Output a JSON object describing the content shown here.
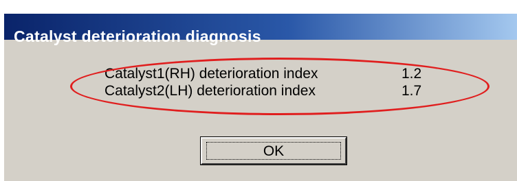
{
  "window": {
    "title": "Catalyst deterioration diagnosis"
  },
  "content": {
    "rows": [
      {
        "label": "Catalyst1(RH) deterioration index",
        "value": "1.2"
      },
      {
        "label": "Catalyst2(LH) deterioration index",
        "value": "1.7"
      }
    ]
  },
  "buttons": {
    "ok_label": "OK"
  },
  "colors": {
    "titlebar_start": "#0a246a",
    "titlebar_end": "#a6caf0",
    "dialog_background": "#d4d0c8",
    "annotation_ellipse": "#e01e1e"
  }
}
